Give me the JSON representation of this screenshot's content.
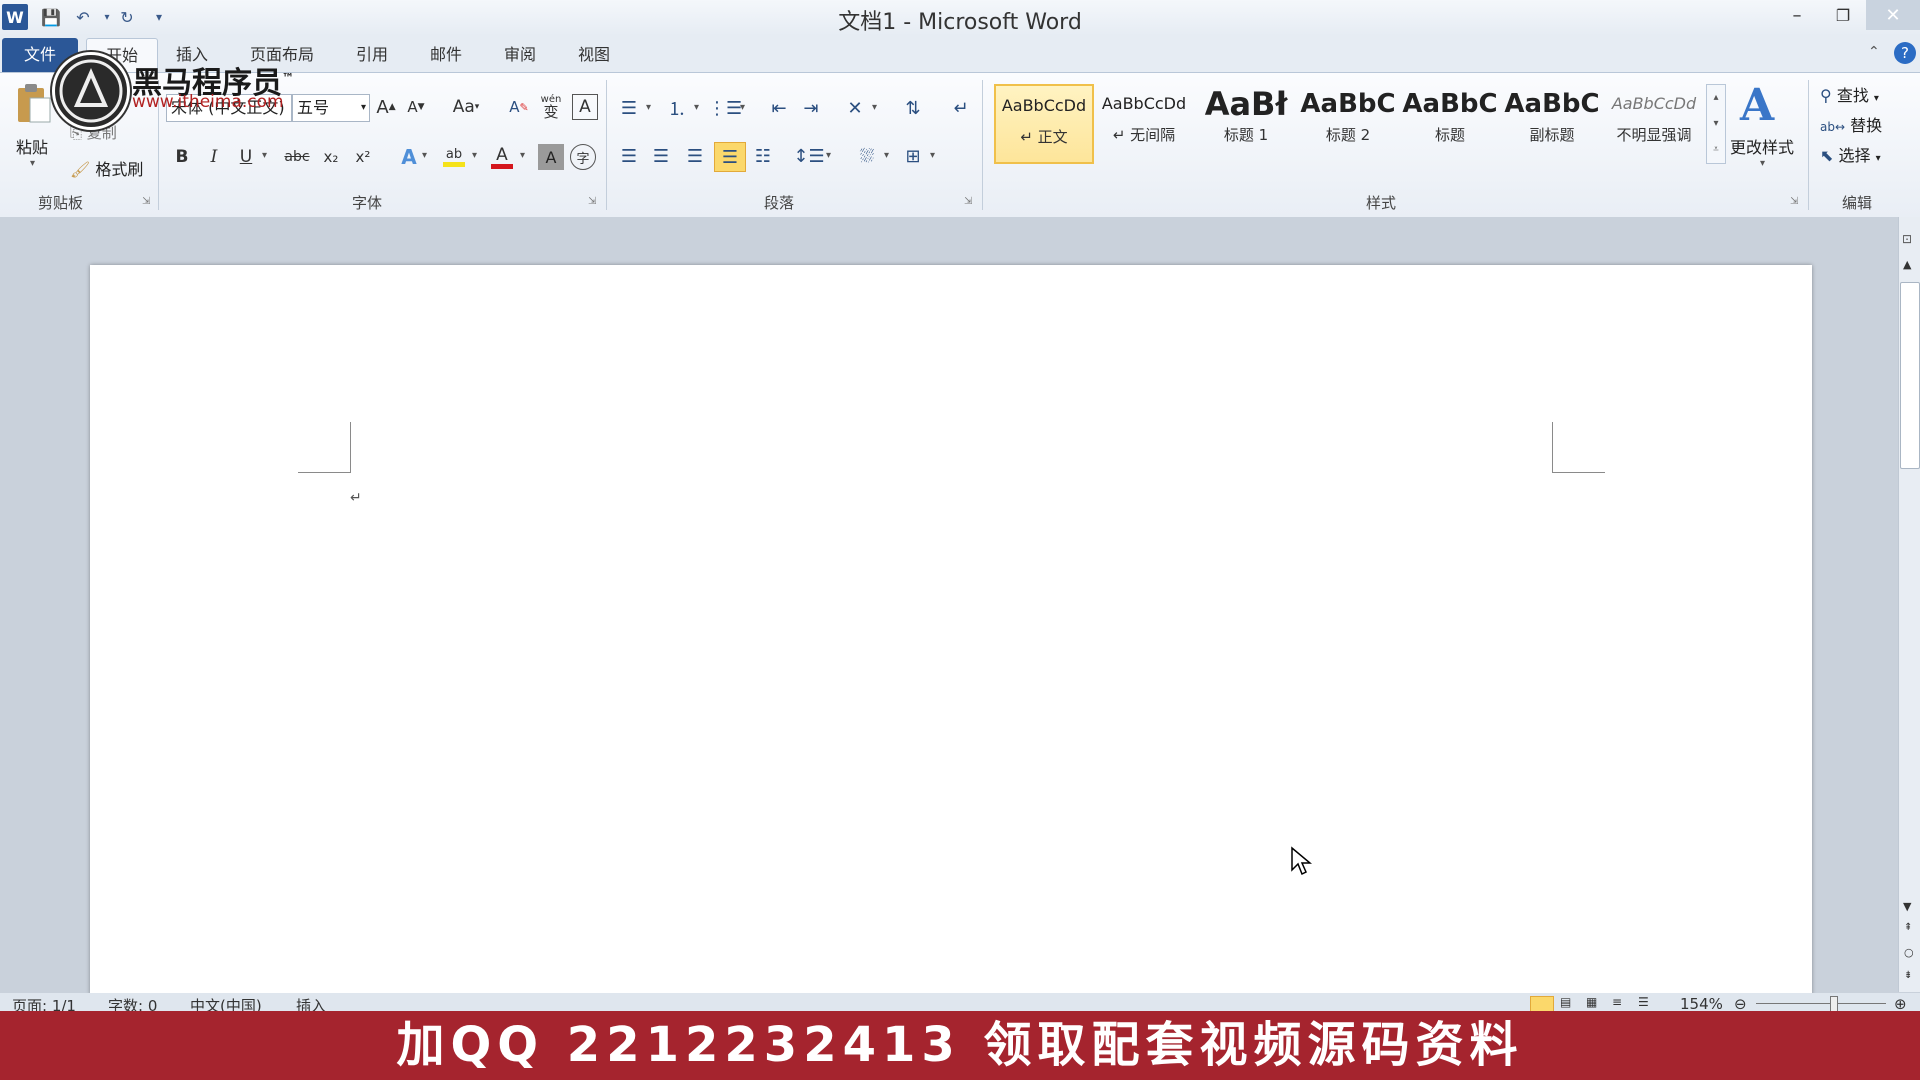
{
  "window": {
    "title": "文档1 - Microsoft Word",
    "minimize": "–",
    "restore": "❐",
    "close": "✕"
  },
  "quick_access": {
    "app_icon": "W",
    "save_icon": "save-icon",
    "undo_icon": "undo-icon",
    "redo_icon": "redo-icon",
    "customize_icon": "dropdown-icon"
  },
  "tabs": [
    "文件",
    "开始",
    "插入",
    "页面布局",
    "引用",
    "邮件",
    "审阅",
    "视图"
  ],
  "ribbon": {
    "clipboard": {
      "paste": "粘贴",
      "cut": "剪切",
      "copy": "复制",
      "format_painter": "格式刷",
      "group_label": "剪贴板"
    },
    "font": {
      "font_name": "宋体 (中文正文)",
      "font_size": "五号",
      "grow": "A",
      "shrink": "A",
      "case": "Aa",
      "bold": "B",
      "italic": "I",
      "underline": "U",
      "strike": "abc",
      "subscript": "x₂",
      "superscript": "x²",
      "text_effect": "A",
      "highlight": "ab",
      "font_color": "A",
      "char_shading": "A",
      "enclose": "字",
      "phonetic": "wén",
      "char_border": "A",
      "clear": "A",
      "group_label": "字体",
      "highlight_color": "#f5e21a",
      "font_color_value": "#d4161d"
    },
    "paragraph": {
      "group_label": "段落"
    },
    "styles": {
      "items": [
        {
          "preview": "AaBbCcDd",
          "name": "↵ 正文"
        },
        {
          "preview": "AaBbCcDd",
          "name": "↵ 无间隔"
        },
        {
          "preview": "AaBł",
          "name": "标题 1"
        },
        {
          "preview": "AaBbC",
          "name": "标题 2"
        },
        {
          "preview": "AaBbC",
          "name": "标题"
        },
        {
          "preview": "AaBbC",
          "name": "副标题"
        },
        {
          "preview": "AaBbCcDd",
          "name": "不明显强调"
        }
      ],
      "change_styles": "更改样式",
      "group_label": "样式"
    },
    "editing": {
      "find": "查找",
      "replace": "替换",
      "select": "选择",
      "group_label": "编辑"
    }
  },
  "document": {
    "paragraph_mark": "↵"
  },
  "status": {
    "page": "页面: 1/1",
    "words": "字数: 0",
    "language": "中文(中国)",
    "mode": "插入",
    "zoom": "154%"
  },
  "watermark": {
    "brand": "黑马程序员",
    "tm": "™",
    "url": "www.itheima.com"
  },
  "banner": "加QQ 2212232413 领取配套视频源码资料"
}
